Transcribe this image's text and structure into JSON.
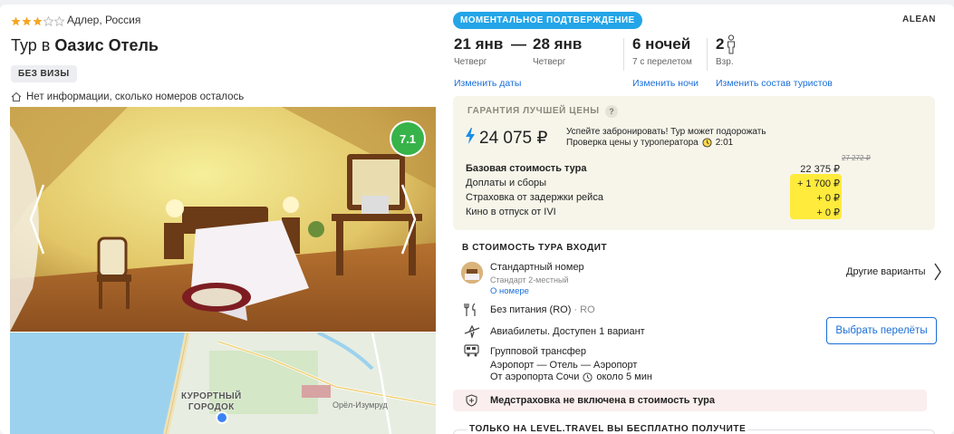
{
  "hotel": {
    "stars": 3,
    "stars_max": 5,
    "location": "Адлер, Россия",
    "title_prefix": "Тур в",
    "title_name": "Оазис Отель",
    "visa_badge": "БЕЗ ВИЗЫ",
    "rooms_info": "Нет информации, сколько номеров осталось",
    "rating": "7.1",
    "map_label_city_line1": "КУРОРТНЫЙ",
    "map_label_city_line2": "ГОРОДОК",
    "map_label_place": "Орёл-Изумруд"
  },
  "booking": {
    "instant_badge": "МОМЕНТАЛЬНОЕ ПОДТВЕРЖДЕНИЕ",
    "operator": "ALEAN",
    "date_from": "21 янв",
    "date_sep": "—",
    "date_to": "28 янв",
    "day_from": "Четверг",
    "day_to": "Четверг",
    "nights": "6 ночей",
    "nights_sub": "7 с перелетом",
    "adults": "2",
    "adults_sub": "Взр.",
    "link_dates": "Изменить даты",
    "link_nights": "Изменить ночи",
    "link_tourists": "Изменить состав туристов"
  },
  "price": {
    "guarantee": "ГАРАНТИЯ ЛУЧШЕЙ ЦЕНЫ",
    "question": "?",
    "total": "24 075 ₽",
    "hurry_line1": "Успейте забронировать! Тур может подорожать",
    "hurry_line2": "Проверка цены у туроператора",
    "timer": "2:01",
    "old_price": "27 272 ₽",
    "rows": [
      {
        "label": "Базовая стоимость тура",
        "value": "22 375 ₽"
      },
      {
        "label": "Доплаты и сборы",
        "value": "+ 1 700 ₽"
      },
      {
        "label": "Страховка от задержки рейса",
        "value": "+ 0 ₽"
      },
      {
        "label": "Кино в отпуск от IVI",
        "value": "+ 0 ₽"
      }
    ]
  },
  "included": {
    "title": "В СТОИМОСТЬ ТУРА ВХОДИТ",
    "room_name": "Стандартный номер",
    "room_sub": "Стандарт 2-местный",
    "room_link": "О номере",
    "other_variants": "Другие варианты",
    "meal": "Без питания (RO)",
    "meal_code": " · RO",
    "flights": "Авиабилеты. Доступен 1 вариант",
    "flights_button": "Выбрать перелёты",
    "transfer_line1": "Групповой трансфер",
    "transfer_line2": "Аэропорт — Отель — Аэропорт",
    "transfer_line3_prefix": "От аэропорта Сочи",
    "transfer_line3_suffix": "около 5 мин",
    "insurance": "Медстраховка не включена в стоимость тура",
    "free_title": "ТОЛЬКО НА LEVEL.TRAVEL ВЫ БЕСПЛАТНО ПОЛУЧИТЕ"
  },
  "colors": {
    "accent": "#1a6ed8",
    "instant_badge": "#23a5e8",
    "rating_green": "#37b349",
    "star": "#f5a623",
    "highlight": "#ffeb3b",
    "insurance_bg": "#fbeeee"
  }
}
